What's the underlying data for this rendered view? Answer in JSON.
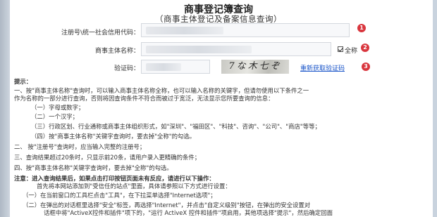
{
  "page": {
    "title": "商事登记簿查询",
    "subtitle": "（商事主体登记及备案信息查询）"
  },
  "form": {
    "reg_no_label": "注册号\\统一社会信用代码：",
    "name_label": "商事主体名称：",
    "captcha_label": "验证码：",
    "fullname_label": "全称",
    "captcha_text": "7な木七ぞ",
    "refresh_link": "重新获取验证码",
    "badges": [
      "1",
      "2",
      "3"
    ]
  },
  "hints": {
    "heading": "提示：",
    "lines": [
      "一、按\"商事主体名称\"查询时，可以输入商事主体名称全称，也可以输入名称的关键字，但请勿使用以下条件之一",
      "作为名称的一部分进行查询，否则将因查询条件不符合而被过于宽泛，无法显示您所要查询的信息：",
      "（一）字母或数字；",
      "（二）一个汉字；",
      "（三）行政区划、行业通称或商事主体组织形式，如\"深圳\"、\"福田区\"、\"科技\"、咨询\"、\"公司\"、\"商店\"等等；",
      "（四）按\"商事主体名称\"关键字查询时，要去掉\"全称\"的勾选。",
      "二、  按\"注册号\"查询时，应当输入完整的注册号；",
      "三、查询结果超过20条时，只显示前20条，请用户录入更精确的条件；",
      "四、按\"商事主体名称\"关键字查询时，要去掉\"全称\"的勾选。",
      "注意：进入查询结果后，如果点击打印按钮页面未有反应，请进行以下操作：",
      "首先将本网站添加到\"受信任的站点\"里面，具体请参照以下方式进行设置：",
      "（一）在当前窗口的工具栏点击\"工具\"，在下拉菜单选择\"Internet选项\"；",
      "（二）在弹出的对话框里选择\"安全\"标签，再选择\"Internet\"，并点击\"自定义级别\"按钮，在弹出的安全设置对",
      "话框中将\"ActiveX控件和插件\"项下的，\"运行 ActiveX 控件和插件\"项启用，其他项选择\"提示\"，然后确定回面"
    ]
  }
}
